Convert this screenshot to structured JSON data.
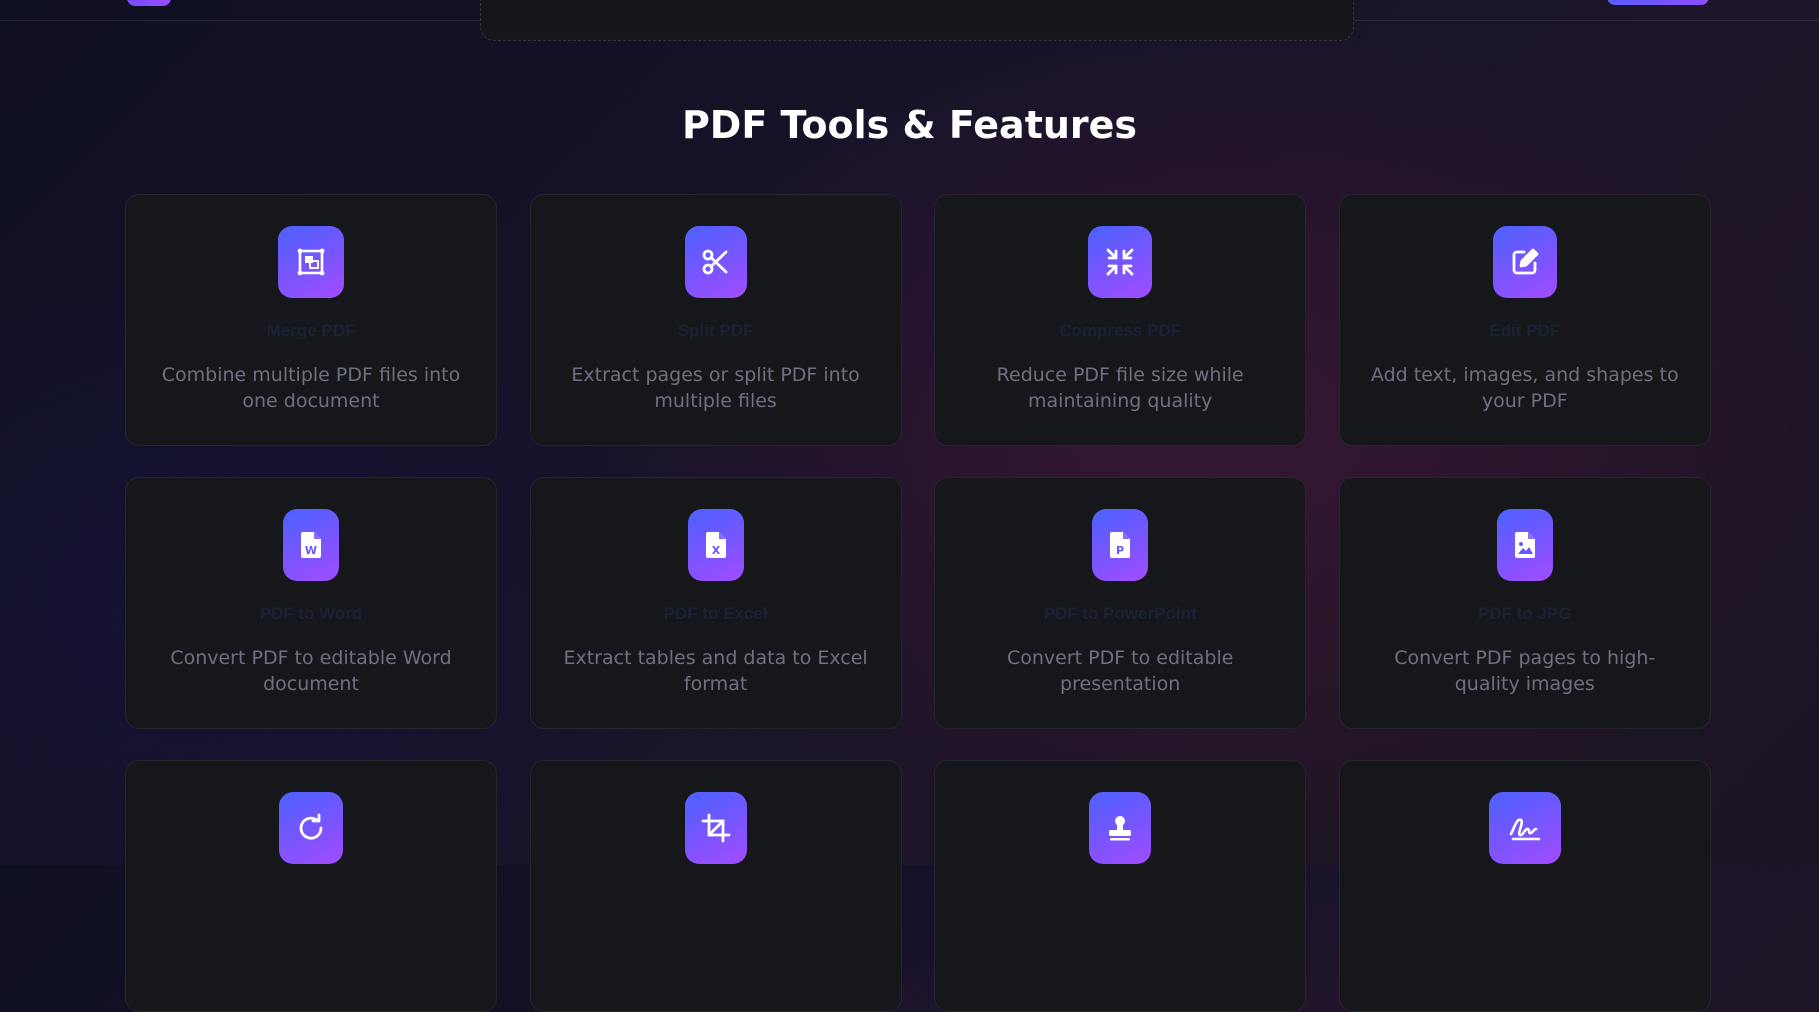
{
  "page": {
    "section_title": "PDF Tools & Features"
  },
  "colors": {
    "background": "#15132a",
    "card_bg": "#16171b",
    "card_border": "#26272e",
    "icon_gradient_start": "#4b62ff",
    "icon_gradient_end": "#a24cff",
    "description_text": "#6d7180",
    "title_text": "#1c2236",
    "heading_text": "#ffffff"
  },
  "tools": [
    {
      "icon": "merge-icon",
      "title": "Merge PDF",
      "description": "Combine multiple PDF files into one document"
    },
    {
      "icon": "scissors-icon",
      "title": "Split PDF",
      "description": "Extract pages or split PDF into multiple files"
    },
    {
      "icon": "compress-icon",
      "title": "Compress PDF",
      "description": "Reduce PDF file size while maintaining quality"
    },
    {
      "icon": "edit-icon",
      "title": "Edit PDF",
      "description": "Add text, images, and shapes to your PDF"
    },
    {
      "icon": "word-file-icon",
      "title": "PDF to Word",
      "description": "Convert PDF to editable Word document"
    },
    {
      "icon": "excel-file-icon",
      "title": "PDF to Excel",
      "description": "Extract tables and data to Excel format"
    },
    {
      "icon": "powerpoint-file-icon",
      "title": "PDF to PowerPoint",
      "description": "Convert PDF to editable presentation"
    },
    {
      "icon": "image-file-icon",
      "title": "PDF to JPG",
      "description": "Convert PDF pages to high-quality images"
    },
    {
      "icon": "rotate-icon",
      "title": "",
      "description": ""
    },
    {
      "icon": "crop-icon",
      "title": "",
      "description": ""
    },
    {
      "icon": "stamp-icon",
      "title": "",
      "description": ""
    },
    {
      "icon": "signature-icon",
      "title": "",
      "description": ""
    }
  ]
}
